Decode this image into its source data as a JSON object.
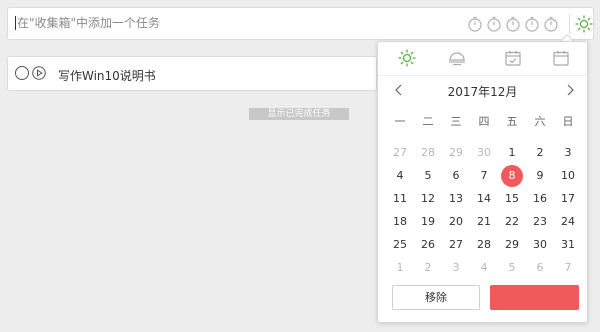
{
  "add_bar": {
    "placeholder": "在\"收集箱\"中添加一个任务",
    "timer_icons": [
      "timer-icon",
      "timer-icon",
      "timer-icon",
      "timer-icon",
      "timer-icon"
    ],
    "date_icon": "sun-icon"
  },
  "tasks": [
    {
      "title": "写作Win10说明书"
    }
  ],
  "show_completed": "显示已完成任务",
  "date_popup": {
    "tabs": [
      "sun-icon",
      "moon-icon",
      "calendar-check-icon",
      "calendar-icon"
    ],
    "active_tab": 0,
    "month_title": "2017年12月",
    "weekdays": [
      "一",
      "二",
      "三",
      "四",
      "五",
      "六",
      "日"
    ],
    "days": [
      {
        "d": "27",
        "other": true
      },
      {
        "d": "28",
        "other": true
      },
      {
        "d": "29",
        "other": true
      },
      {
        "d": "30",
        "other": true
      },
      {
        "d": "1"
      },
      {
        "d": "2"
      },
      {
        "d": "3"
      },
      {
        "d": "4"
      },
      {
        "d": "5"
      },
      {
        "d": "6"
      },
      {
        "d": "7"
      },
      {
        "d": "8",
        "today": true
      },
      {
        "d": "9"
      },
      {
        "d": "10"
      },
      {
        "d": "11"
      },
      {
        "d": "12"
      },
      {
        "d": "13"
      },
      {
        "d": "14"
      },
      {
        "d": "15"
      },
      {
        "d": "16"
      },
      {
        "d": "17"
      },
      {
        "d": "18"
      },
      {
        "d": "19"
      },
      {
        "d": "20"
      },
      {
        "d": "21"
      },
      {
        "d": "22"
      },
      {
        "d": "23"
      },
      {
        "d": "24"
      },
      {
        "d": "25"
      },
      {
        "d": "26"
      },
      {
        "d": "27"
      },
      {
        "d": "28"
      },
      {
        "d": "29"
      },
      {
        "d": "30"
      },
      {
        "d": "31"
      },
      {
        "d": "1",
        "other": true
      },
      {
        "d": "2",
        "other": true
      },
      {
        "d": "3",
        "other": true
      },
      {
        "d": "4",
        "other": true
      },
      {
        "d": "5",
        "other": true
      },
      {
        "d": "6",
        "other": true
      },
      {
        "d": "7",
        "other": true
      }
    ],
    "remove_label": "移除",
    "confirm_label": ""
  },
  "colors": {
    "accent_green": "#57b03b",
    "today_red": "#f05a5a",
    "confirm_red": "#f05a5a"
  }
}
